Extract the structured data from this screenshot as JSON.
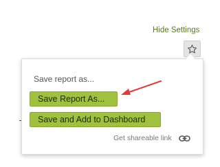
{
  "header": {
    "hide_settings_label": "Hide Settings",
    "star_icon": "star-icon"
  },
  "popup": {
    "title": "Save report as...",
    "buttons": {
      "save_report_as": "Save Report As...",
      "save_and_add_dashboard": "Save and Add to Dashboard"
    },
    "share_link_label": "Get shareable link",
    "link_icon": "link-icon"
  },
  "annotation": {
    "arrow_icon": "red-arrow-icon",
    "arrow_color": "#e53935"
  },
  "colors": {
    "accent_green": "#a0c13d",
    "link_green": "#5b7c15"
  }
}
